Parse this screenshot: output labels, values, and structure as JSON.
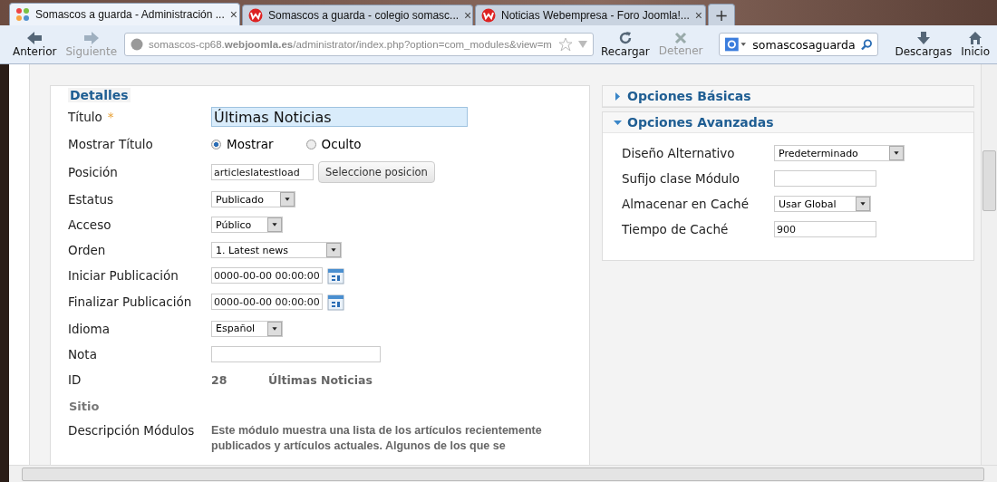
{
  "browser": {
    "tabs": [
      {
        "title": "Somascos a guarda - Administración ...",
        "selected": true,
        "close": "×"
      },
      {
        "title": "Somascos a guarda - colegio somasc...",
        "selected": false,
        "close": "×"
      },
      {
        "title": "Noticias Webempresa - Foro Joomla!...",
        "selected": false,
        "close": "×"
      }
    ],
    "new_tab": "+",
    "nav": [
      {
        "kind": "back",
        "label": "Anterior",
        "disabled": false
      },
      {
        "kind": "forward",
        "label": "Siguiente",
        "disabled": true
      }
    ],
    "url": "somascos-cp68.**webjoomla.es**/administrator/index.php?option=com_modules&view=m",
    "actions": [
      {
        "kind": "reload",
        "label": "Recargar",
        "disabled": false
      },
      {
        "kind": "stop",
        "label": "Detener",
        "disabled": true
      }
    ],
    "search": {
      "value": "somascosaguarda"
    },
    "tools": [
      {
        "kind": "download",
        "label": "Descargas"
      },
      {
        "kind": "home",
        "label": "Inicio"
      }
    ]
  },
  "details": {
    "legend": "Detalles",
    "rows": [
      {
        "kind": "title",
        "label": "Título",
        "required": "*",
        "value": "Últimas Noticias"
      },
      {
        "kind": "radio",
        "label": "Mostrar Título",
        "options": [
          {
            "label": "Mostrar",
            "selected": true
          },
          {
            "label": "Oculto",
            "selected": false
          }
        ]
      },
      {
        "kind": "position",
        "label": "Posición",
        "value": "articleslatestload",
        "button": "Seleccione posicion"
      },
      {
        "kind": "select",
        "label": "Estatus",
        "value": "Publicado"
      },
      {
        "kind": "select",
        "label": "Acceso",
        "value": "Público"
      },
      {
        "kind": "select",
        "label": "Orden",
        "value": "1. Latest news"
      },
      {
        "kind": "date",
        "label": "Iniciar Publicación",
        "value": "0000-00-00 00:00:00"
      },
      {
        "kind": "date",
        "label": "Finalizar Publicación",
        "value": "0000-00-00 00:00:00"
      },
      {
        "kind": "select",
        "label": "Idioma",
        "value": "Español"
      },
      {
        "kind": "text",
        "label": "Nota"
      },
      {
        "kind": "id",
        "label": "ID",
        "value": "28",
        "name": "Últimas Noticias"
      },
      {
        "kind": "heading",
        "label": "Sitio"
      },
      {
        "kind": "description",
        "label": "Descripción Módulos",
        "value": "Este módulo muestra una lista de los artículos recientemente publicados y artículos actuales. Algunos de los que se"
      }
    ]
  },
  "options": [
    {
      "title": "Opciones Básicas",
      "expanded": false
    },
    {
      "title": "Opciones Avanzadas",
      "expanded": true,
      "rows": [
        {
          "kind": "select",
          "label": "Diseño Alternativo",
          "value": "Predeterminado"
        },
        {
          "kind": "text",
          "label": "Sufijo clase Módulo"
        },
        {
          "kind": "select",
          "label": "Almacenar en Caché",
          "value": "Usar Global"
        },
        {
          "kind": "text",
          "label": "Tiempo de Caché",
          "value": "900"
        }
      ]
    }
  ]
}
